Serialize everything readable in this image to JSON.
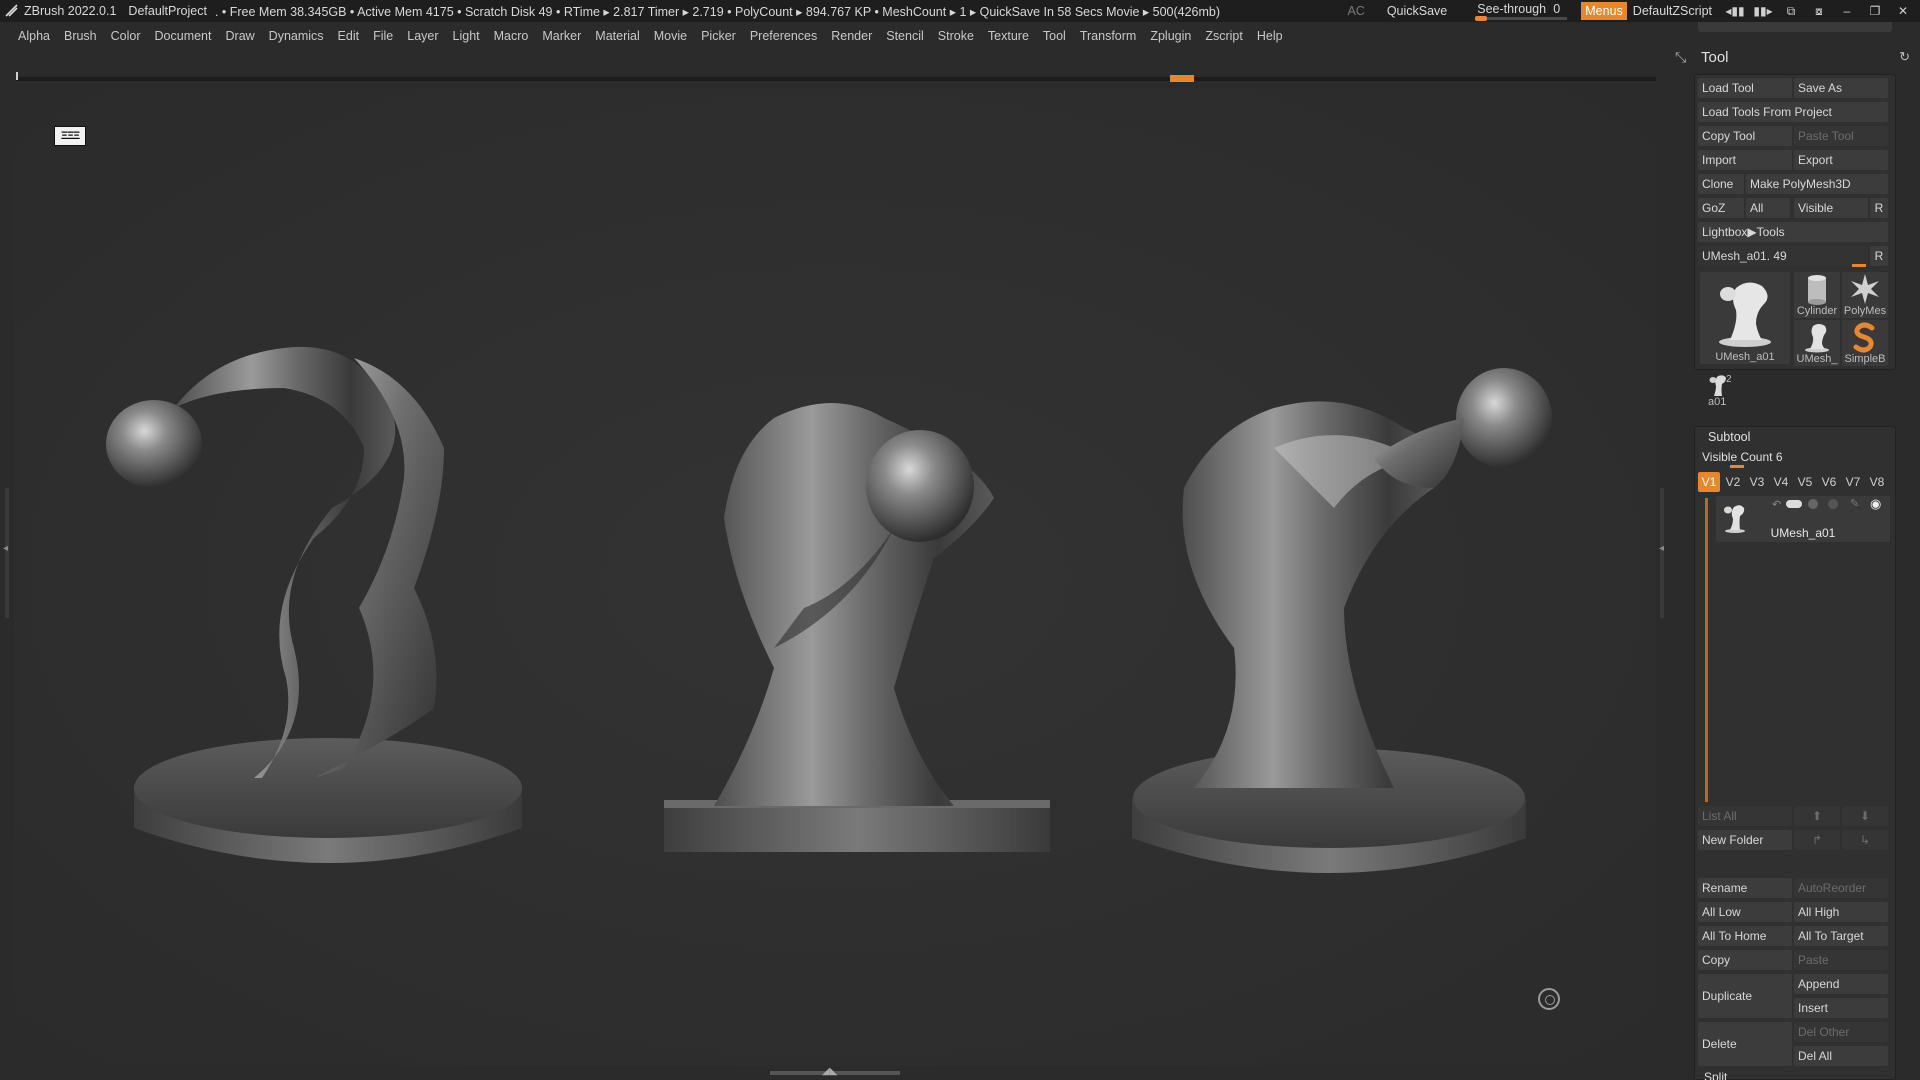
{
  "titlebar": {
    "app": "ZBrush 2022.0.1",
    "project": "DefaultProject",
    "stats": ". • Free Mem 38.345GB • Active Mem 4175 • Scratch Disk 49 •  RTime ▸ 2.817 Timer ▸ 2.719 • PolyCount ▸ 894.767 KP  • MeshCount ▸ 1  ▸ QuickSave In 58 Secs Movie ▸ 500(426mb)",
    "ac": "AC",
    "quicksave": "QuickSave",
    "seethrough_label": "See-through",
    "seethrough_value": "0",
    "menus": "Menus",
    "zscript": "DefaultZScript"
  },
  "menubar": [
    "Alpha",
    "Brush",
    "Color",
    "Document",
    "Draw",
    "Dynamics",
    "Edit",
    "File",
    "Layer",
    "Light",
    "Macro",
    "Marker",
    "Material",
    "Movie",
    "Picker",
    "Preferences",
    "Render",
    "Stencil",
    "Stroke",
    "Texture",
    "Tool",
    "Transform",
    "Zplugin",
    "Zscript",
    "Help"
  ],
  "canvas": {
    "persp_label": "ΞΞΞ"
  },
  "tool": {
    "title": "Tool",
    "load_tool": "Load Tool",
    "save_as": "Save As",
    "load_from_project": "Load Tools From Project",
    "copy_tool": "Copy Tool",
    "paste_tool": "Paste Tool",
    "import": "Import",
    "export": "Export",
    "clone": "Clone",
    "make_polymesh": "Make PolyMesh3D",
    "goz": "GoZ",
    "all": "All",
    "visible": "Visible",
    "r": "R",
    "lightbox_tools": "Lightbox▶Tools",
    "current_tool": "UMesh_a01. 49",
    "thumbs": {
      "main": "UMesh_a01",
      "cylinder": "Cylinder",
      "polymesh": "PolyMes",
      "umesh_small": "UMesh_",
      "simpleb": "SimpleB",
      "a01": "a01",
      "a01_count": "2"
    }
  },
  "subtool": {
    "title": "Subtool",
    "visible_count": "Visible Count 6",
    "vtabs": [
      "V1",
      "V2",
      "V3",
      "V4",
      "V5",
      "V6",
      "V7",
      "V8"
    ],
    "active_name": "UMesh_a01",
    "list_all": "List All",
    "new_folder": "New Folder",
    "rename": "Rename",
    "autoreorder": "AutoReorder",
    "all_low": "All Low",
    "all_high": "All High",
    "all_to_home": "All To Home",
    "all_to_target": "All To Target",
    "copy": "Copy",
    "paste": "Paste",
    "duplicate": "Duplicate",
    "append": "Append",
    "insert": "Insert",
    "delete": "Delete",
    "del_other": "Del Other",
    "del_all": "Del All",
    "split": "Split"
  },
  "colors": {
    "accent": "#e8872d",
    "bg": "#262626",
    "panel": "#2b2b2b"
  }
}
